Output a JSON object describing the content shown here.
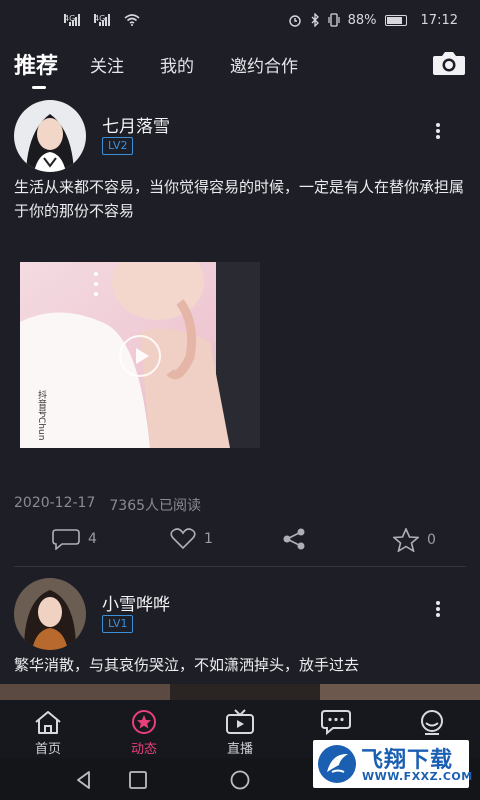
{
  "status_bar": {
    "sim1_tag": "4G",
    "sim2_tag": "4G",
    "battery_percent": "88%",
    "time": "17:12"
  },
  "top_tabs": [
    {
      "label": "推荐",
      "active": true
    },
    {
      "label": "关注",
      "active": false
    },
    {
      "label": "我的",
      "active": false
    },
    {
      "label": "邀约合作",
      "active": false
    }
  ],
  "posts": [
    {
      "username": "七月落雪",
      "level": "LV2",
      "text": "生活从来都不容易，当你觉得容易的时候，一定是有人在替你承担属于你的那份不容易",
      "video_watermark": "抖音号Chun",
      "date": "2020-12-17",
      "reads": "7365人已阅读",
      "comments": "4",
      "likes": "1",
      "favorites": "0"
    },
    {
      "username": "小雪哗哗",
      "level": "LV1",
      "text": "繁华消散，与其哀伤哭泣，不如潇洒掉头，放手过去"
    }
  ],
  "bottom_nav": [
    {
      "label": "首页",
      "icon": "home-icon",
      "active": false
    },
    {
      "label": "动态",
      "icon": "star-icon",
      "active": true
    },
    {
      "label": "直播",
      "icon": "tv-icon",
      "active": false
    },
    {
      "label": "",
      "icon": "message-icon",
      "active": false
    },
    {
      "label": "",
      "icon": "profile-icon",
      "active": false
    }
  ],
  "watermark_badge": {
    "name": "飞翔下载",
    "url": "WWW.FXXZ.COM"
  },
  "colors": {
    "background": "#1e1f26",
    "accent_pink": "#e9407a",
    "level_badge_blue": "#3a8fd8"
  }
}
